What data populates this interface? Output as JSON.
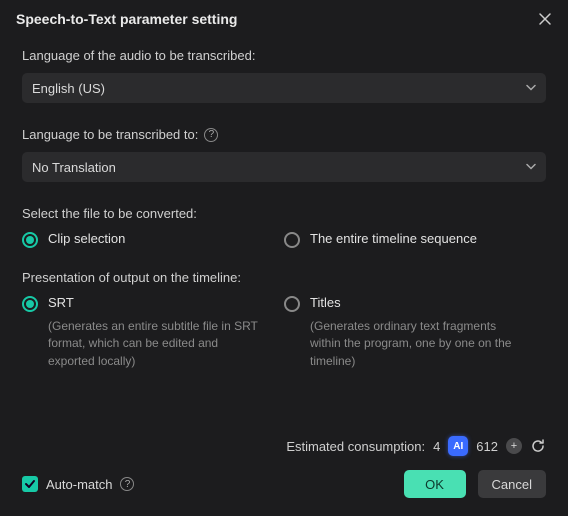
{
  "dialog": {
    "title": "Speech-to-Text parameter setting"
  },
  "source_language": {
    "label": "Language of the audio to be transcribed:",
    "value": "English (US)"
  },
  "target_language": {
    "label": "Language to be transcribed to:",
    "value": "No Translation"
  },
  "file_selection": {
    "label": "Select the file to be converted:",
    "options": {
      "clip": "Clip selection",
      "timeline": "The entire timeline sequence"
    },
    "selected": "clip"
  },
  "output_presentation": {
    "label": "Presentation of output on the timeline:",
    "options": {
      "srt": {
        "label": "SRT",
        "desc": "(Generates an entire subtitle file in SRT format, which can be edited and exported locally)"
      },
      "titles": {
        "label": "Titles",
        "desc": "(Generates ordinary text fragments within the program, one by one on the timeline)"
      }
    },
    "selected": "srt"
  },
  "footer": {
    "estimated_label": "Estimated consumption:",
    "estimated_value": "4",
    "credits": "612",
    "auto_match_label": "Auto-match",
    "ok": "OK",
    "cancel": "Cancel"
  }
}
